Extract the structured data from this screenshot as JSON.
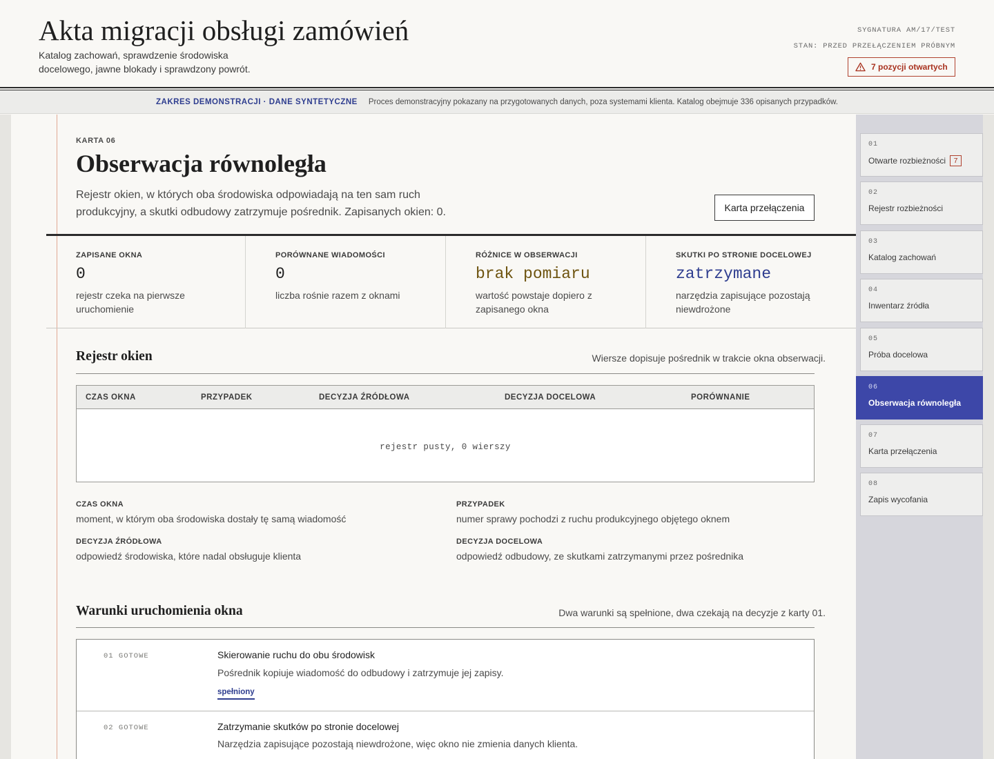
{
  "header": {
    "title": "Akta migracji obsługi zamówień",
    "subtitle": "Katalog zachowań, sprawdzenie środowiska docelowego, jawne blokady i sprawdzony powrót.",
    "signature": "SYGNATURA AM/17/TEST",
    "state": "STAN: PRZED PRZEŁĄCZENIEM PRÓBNYM",
    "open_items": "7 pozycji otwartych"
  },
  "demo_strip": {
    "tag": "ZAKRES DEMONSTRACJI · DANE SYNTETYCZNE",
    "text": "Proces demonstracyjny pokazany na przygotowanych danych, poza systemami klienta. Katalog obejmuje 336 opisanych przypadków."
  },
  "card": {
    "label": "KARTA 06",
    "title": "Obserwacja równoległa",
    "description": "Rejestr okien, w których oba środowiska odpowiadają na ten sam ruch produkcyjny, a skutki odbudowy zatrzymuje pośrednik. Zapisanych okien: 0.",
    "switch_button": "Karta przełączenia"
  },
  "stats": [
    {
      "label": "ZAPISANE OKNA",
      "value": "0",
      "note": "rejestr czeka na pierwsze uruchomienie"
    },
    {
      "label": "PORÓWNANE WIADOMOŚCI",
      "value": "0",
      "note": "liczba rośnie razem z oknami"
    },
    {
      "label": "RÓŻNICE W OBSERWACJI",
      "value": "brak pomiaru",
      "note": "wartość powstaje dopiero z zapisanego okna"
    },
    {
      "label": "SKUTKI PO STRONIE DOCELOWEJ",
      "value": "zatrzymane",
      "note": "narzędzia zapisujące pozostają niewdrożone"
    }
  ],
  "register": {
    "title": "Rejestr okien",
    "note": "Wiersze dopisuje pośrednik w trakcie okna obserwacji.",
    "columns": [
      "CZAS OKNA",
      "PRZYPADEK",
      "DECYZJA ŹRÓDŁOWA",
      "DECYZJA DOCELOWA",
      "PORÓWNANIE"
    ],
    "empty": "rejestr pusty, 0 wierszy",
    "legend": [
      {
        "term": "CZAS OKNA",
        "def": "moment, w którym oba środowiska dostały tę samą wiadomość"
      },
      {
        "term": "PRZYPADEK",
        "def": "numer sprawy pochodzi z ruchu produkcyjnego objętego oknem"
      },
      {
        "term": "DECYZJA ŹRÓDŁOWA",
        "def": "odpowiedź środowiska, które nadal obsługuje klienta"
      },
      {
        "term": "DECYZJA DOCELOWA",
        "def": "odpowiedź odbudowy, ze skutkami zatrzymanymi przez pośrednika"
      }
    ]
  },
  "conditions": {
    "title": "Warunki uruchomienia okna",
    "note": "Dwa warunki są spełnione, dwa czekają na decyzje z karty 01.",
    "items": [
      {
        "num": "01  GOTOWE",
        "title": "Skierowanie ruchu do obu środowisk",
        "desc": "Pośrednik kopiuje wiadomość do odbudowy i zatrzymuje jej zapisy.",
        "status": "spełniony"
      },
      {
        "num": "02  GOTOWE",
        "title": "Zatrzymanie skutków po stronie docelowej",
        "desc": "Narzędzia zapisujące pozostają niewdrożone, więc okno nie zmienia danych klienta."
      }
    ]
  },
  "nav": [
    {
      "num": "01",
      "label": "Otwarte rozbieżności",
      "count": "7"
    },
    {
      "num": "02",
      "label": "Rejestr rozbieżności"
    },
    {
      "num": "03",
      "label": "Katalog zachowań"
    },
    {
      "num": "04",
      "label": "Inwentarz źródła"
    },
    {
      "num": "05",
      "label": "Próba docelowa"
    },
    {
      "num": "06",
      "label": "Obserwacja równoległa",
      "active": true
    },
    {
      "num": "07",
      "label": "Karta przełączenia"
    },
    {
      "num": "08",
      "label": "Zapis wycofania"
    }
  ],
  "colors": {
    "accent": "#3d47a8",
    "warning": "#a8321f",
    "measure": "#6e5410",
    "info": "#2e3d8f"
  }
}
